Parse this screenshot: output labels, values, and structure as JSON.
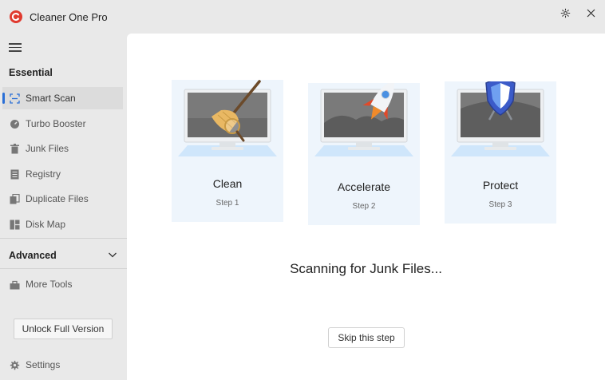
{
  "window": {
    "title": "Cleaner One Pro",
    "controls": [
      "gear-icon",
      "close-icon"
    ]
  },
  "sidebar": {
    "section_essential": "Essential",
    "items": [
      {
        "label": "Smart Scan",
        "icon": "smart-scan-icon",
        "active": true
      },
      {
        "label": "Turbo Booster",
        "icon": "turbo-icon",
        "active": false
      },
      {
        "label": "Junk Files",
        "icon": "trash-icon",
        "active": false
      },
      {
        "label": "Registry",
        "icon": "registry-icon",
        "active": false
      },
      {
        "label": "Duplicate Files",
        "icon": "duplicate-icon",
        "active": false
      },
      {
        "label": "Disk Map",
        "icon": "disk-map-icon",
        "active": false
      }
    ],
    "section_advanced": "Advanced",
    "more_tools": "More Tools",
    "unlock_label": "Unlock Full Version",
    "settings_label": "Settings"
  },
  "main": {
    "steps": [
      {
        "title": "Clean",
        "step": "Step 1",
        "art": "broom-magnifier-icon"
      },
      {
        "title": "Accelerate",
        "step": "Step 2",
        "art": "rocket-icon"
      },
      {
        "title": "Protect",
        "step": "Step 3",
        "art": "shield-swords-icon"
      }
    ],
    "status_text": "Scanning for Junk Files...",
    "skip_label": "Skip this step"
  },
  "colors": {
    "accent": "#2a6fd6",
    "brand_red": "#e03a2f",
    "card_bg": "#eef5fc",
    "sidebar_bg": "#e9e9e9"
  }
}
